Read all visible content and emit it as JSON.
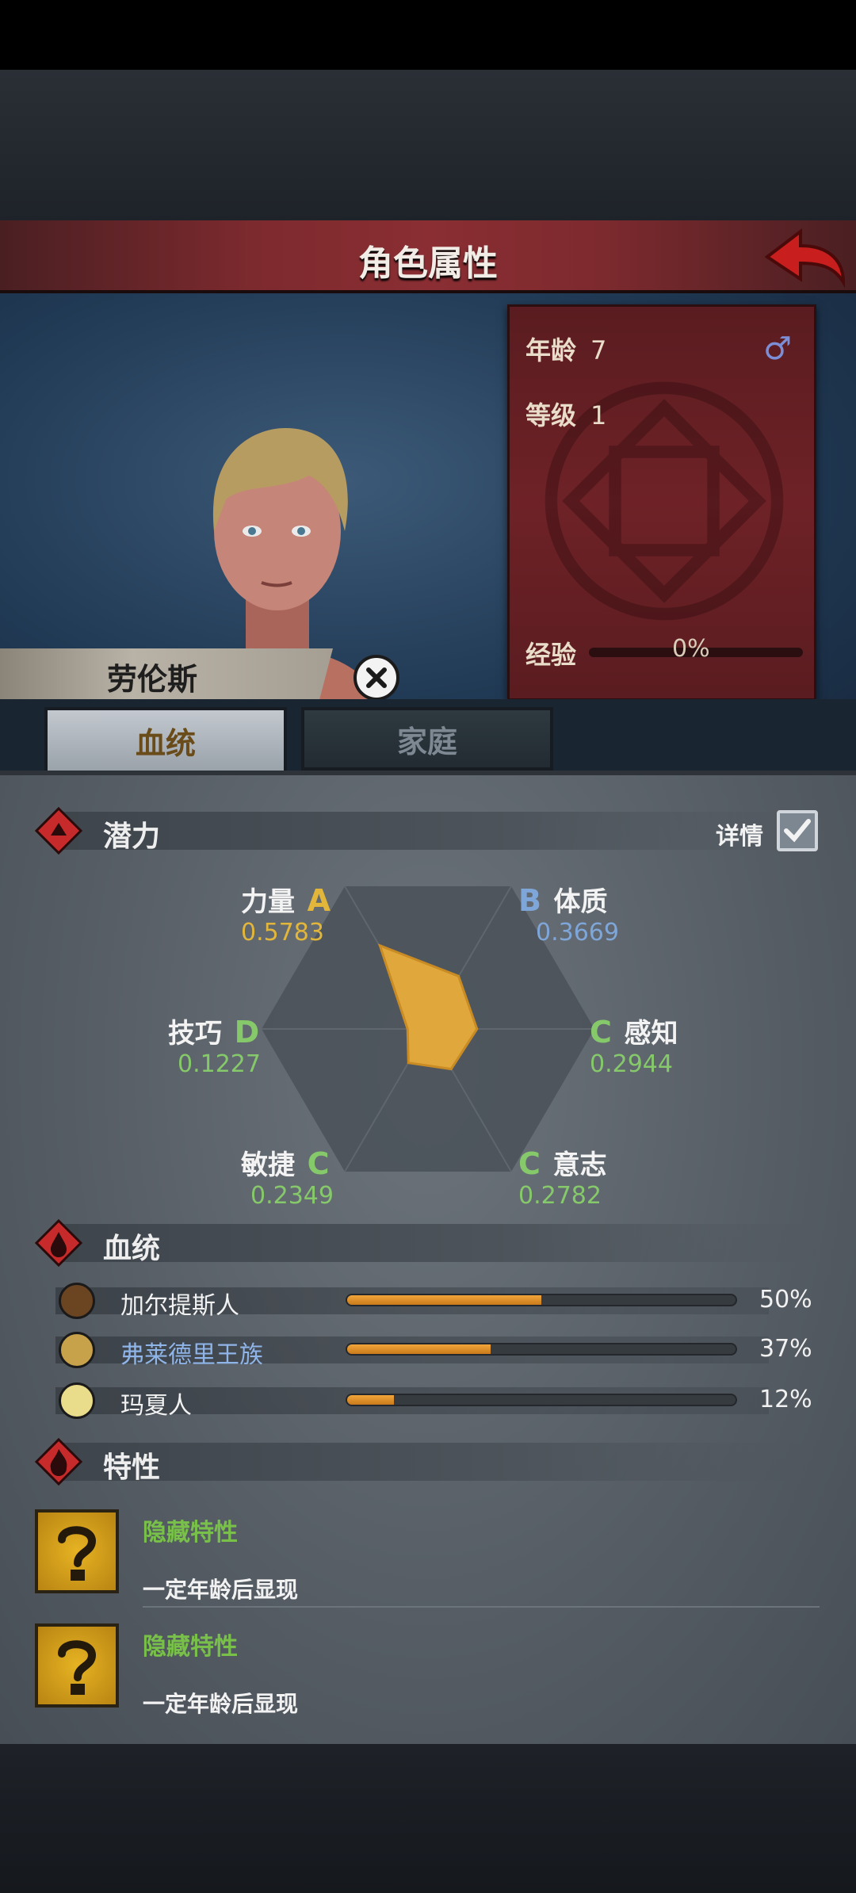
{
  "header": {
    "title": "角色属性"
  },
  "character": {
    "name": "劳伦斯",
    "age_label": "年龄",
    "age": "7",
    "level_label": "等级",
    "level": "1",
    "exp_label": "经验",
    "exp_pct": "0%",
    "gender": "♂"
  },
  "tabs": {
    "bloodline": "血统",
    "family": "家庭"
  },
  "potential": {
    "title": "潜力",
    "detail_label": "详情",
    "stats": [
      {
        "name": "力量",
        "grade": "A",
        "value": "0.5783",
        "color": "#e2b63a"
      },
      {
        "name": "体质",
        "grade": "B",
        "value": "0.3669",
        "color": "#7fa6d9"
      },
      {
        "name": "感知",
        "grade": "C",
        "value": "0.2944",
        "color": "#86c96a"
      },
      {
        "name": "意志",
        "grade": "C",
        "value": "0.2782",
        "color": "#86c96a"
      },
      {
        "name": "敏捷",
        "grade": "C",
        "value": "0.2349",
        "color": "#86c96a"
      },
      {
        "name": "技巧",
        "grade": "D",
        "value": "0.1227",
        "color": "#86c96a"
      }
    ]
  },
  "bloodline": {
    "title": "血统",
    "rows": [
      {
        "name": "加尔提斯人",
        "pct": "50%",
        "fill": 0.5,
        "name_color": "#f2f2f2"
      },
      {
        "name": "弗莱德里王族",
        "pct": "37%",
        "fill": 0.37,
        "name_color": "#8fb4e8"
      },
      {
        "name": "玛夏人",
        "pct": "12%",
        "fill": 0.12,
        "name_color": "#f2f2f2"
      }
    ]
  },
  "traits": {
    "title": "特性",
    "items": [
      {
        "name": "隐藏特性",
        "desc": "一定年龄后显现"
      },
      {
        "name": "隐藏特性",
        "desc": "一定年龄后显现"
      }
    ]
  }
}
